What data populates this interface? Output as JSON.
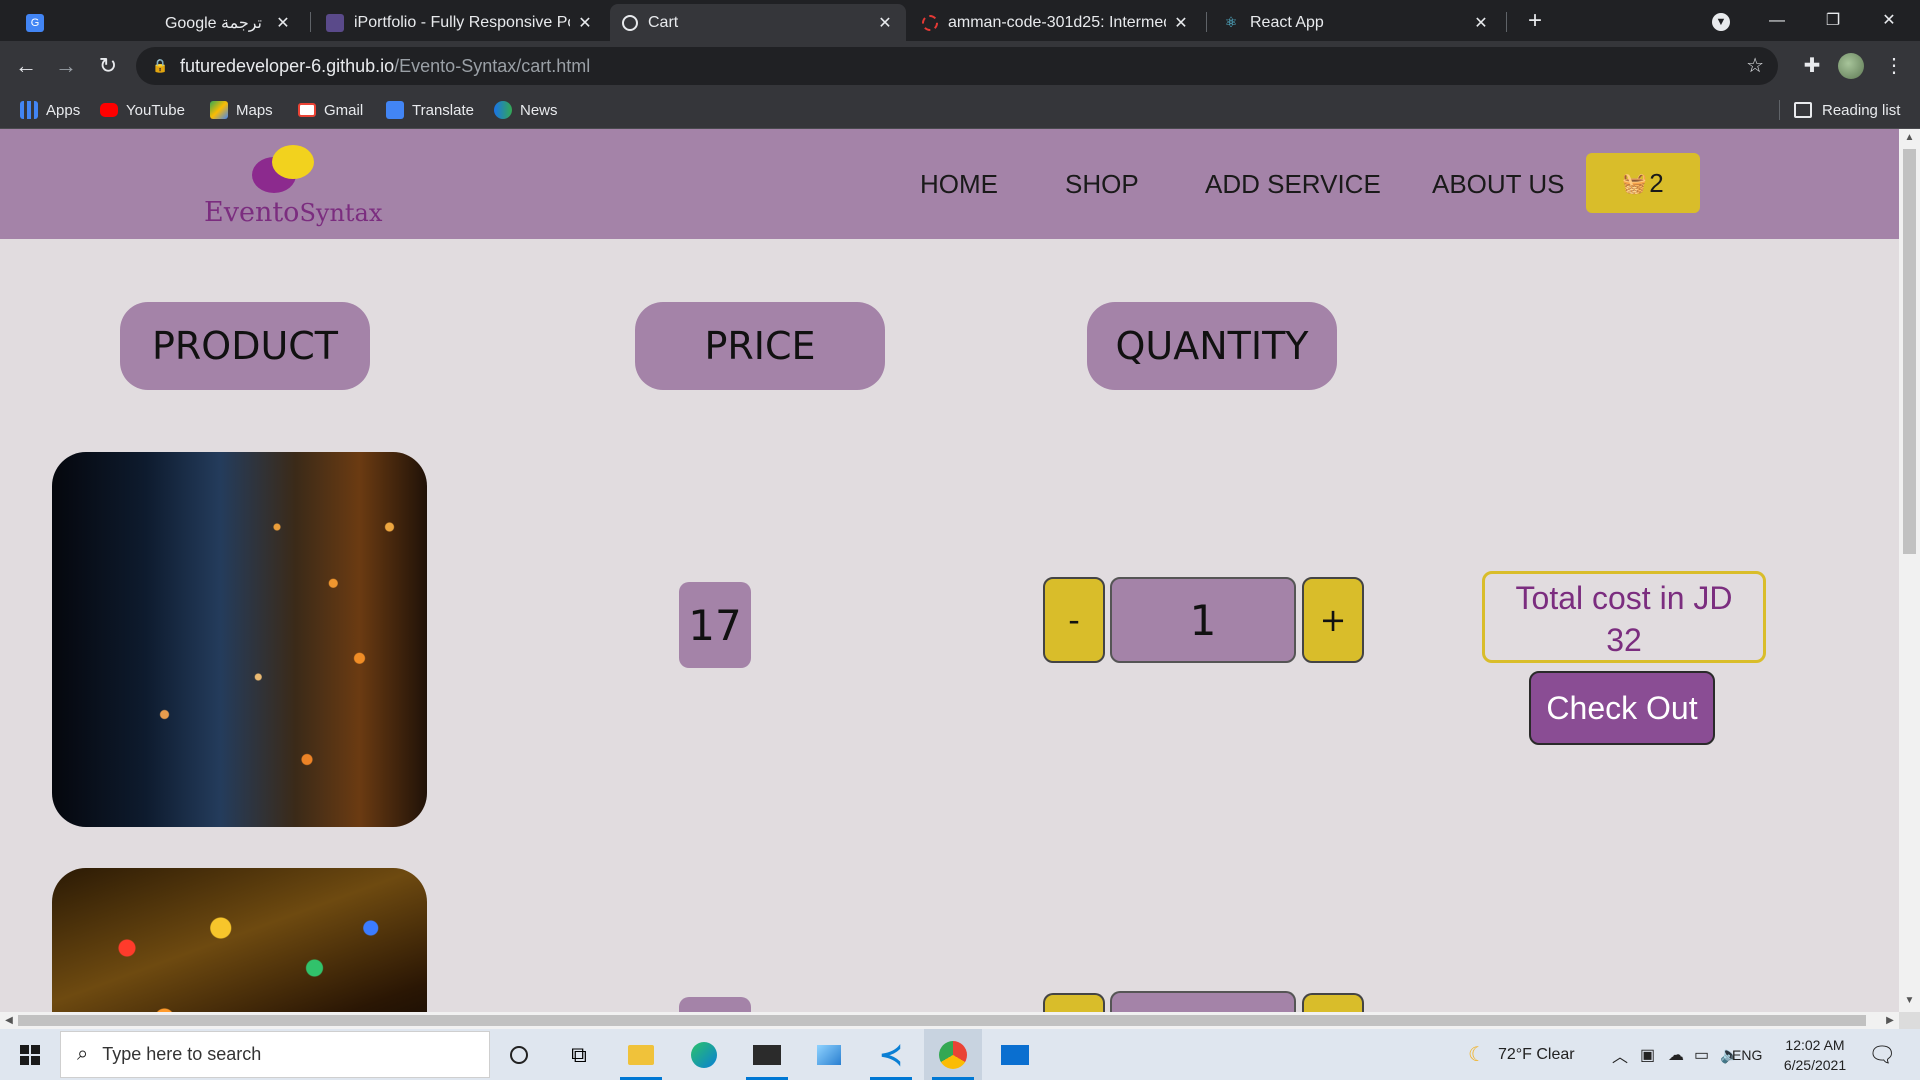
{
  "tabs": [
    {
      "title": "Google ترجمة",
      "icon": "google-translate-icon"
    },
    {
      "title": "iPortfolio - Fully Responsive Portf",
      "icon": "portfolio-icon"
    },
    {
      "title": "Cart",
      "icon": "globe-icon",
      "active": true
    },
    {
      "title": "amman-code-301d25: Intermedi",
      "icon": "code-fellows-icon"
    },
    {
      "title": "React App",
      "icon": "react-icon"
    }
  ],
  "address_bar": {
    "host": "futuredeveloper-6.github.io",
    "path": "/Evento-Syntax/cart.html"
  },
  "bookmarks": [
    {
      "label": "Apps",
      "icon": "apps-grid-icon",
      "color": "#4285f4"
    },
    {
      "label": "YouTube",
      "icon": "youtube-icon",
      "color": "#ff0000"
    },
    {
      "label": "Maps",
      "icon": "maps-icon",
      "color": "#34a853"
    },
    {
      "label": "Gmail",
      "icon": "gmail-icon",
      "color": "#ea4335"
    },
    {
      "label": "Translate",
      "icon": "translate-icon",
      "color": "#4285f4"
    },
    {
      "label": "News",
      "icon": "news-icon",
      "color": "#1a73e8"
    }
  ],
  "reading_list": "Reading list",
  "site": {
    "logo_main": "Evento",
    "logo_sub": "Syntax",
    "nav": [
      "HOME",
      "SHOP",
      "ADD SERVICE",
      "ABOUT US"
    ],
    "cart_count": "2"
  },
  "columns": {
    "product": "PRODUCT",
    "price": "PRICE",
    "quantity": "QUANTITY"
  },
  "cart_items": [
    {
      "price": "17",
      "quantity": "1",
      "minus": "-",
      "plus": "+"
    }
  ],
  "summary": {
    "total_label": "Total cost in JD",
    "total_value": "32",
    "checkout": "Check Out"
  },
  "taskbar": {
    "search_placeholder": "Type here to search",
    "weather": "72°F  Clear",
    "language": "ENG",
    "time": "12:02 AM",
    "date": "6/25/2021"
  },
  "colors": {
    "header_purple": "#a483a8",
    "accent_yellow": "#d9bd2a",
    "checkout_purple": "#8a4d94",
    "page_bg": "#e1dcdf"
  }
}
